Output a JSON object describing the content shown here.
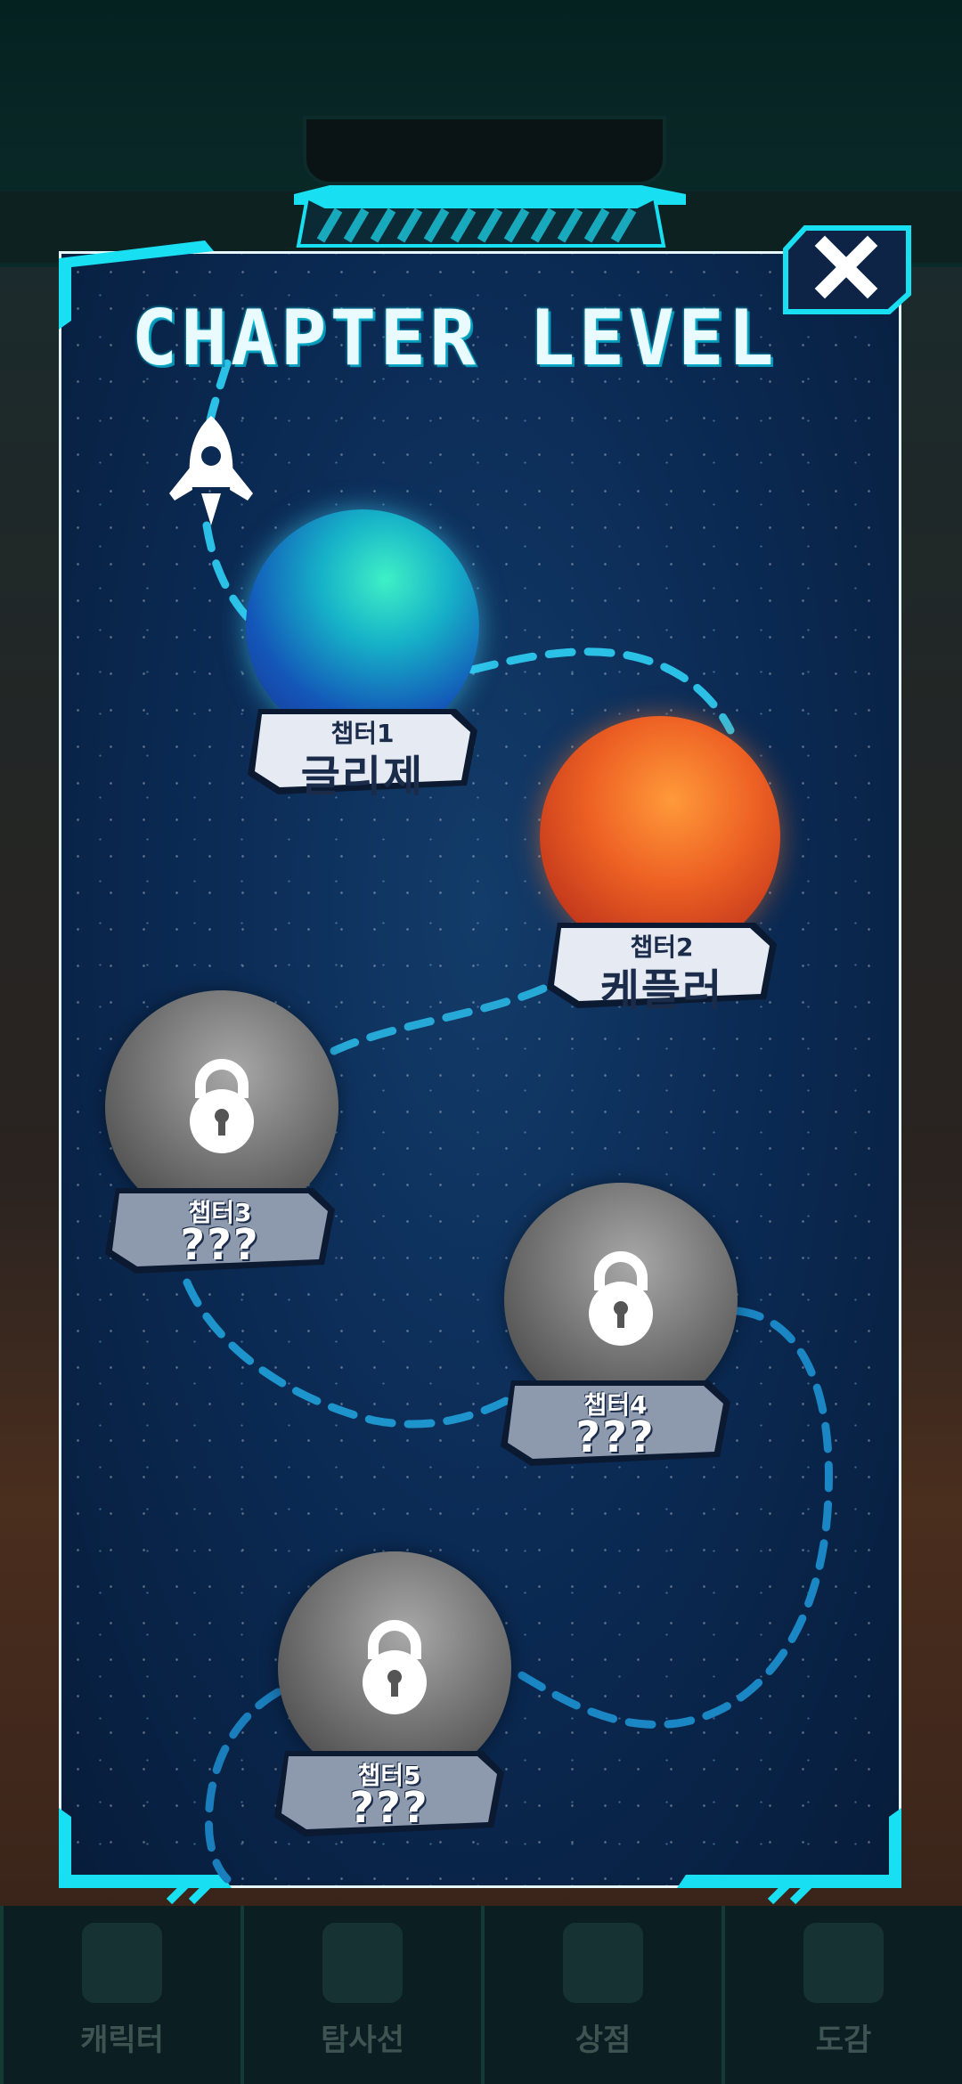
{
  "title": "CHAPTER LEVEL",
  "chapters": [
    {
      "sub": "챕터1",
      "name": "글리제",
      "state": "unlocked",
      "color": "teal"
    },
    {
      "sub": "챕터2",
      "name": "케플러",
      "state": "unlocked",
      "color": "orange"
    },
    {
      "sub": "챕터3",
      "name": "???",
      "state": "locked"
    },
    {
      "sub": "챕터4",
      "name": "???",
      "state": "locked"
    },
    {
      "sub": "챕터5",
      "name": "???",
      "state": "locked"
    }
  ],
  "bottom_nav": [
    {
      "label": "캐릭터",
      "icon": "character-icon"
    },
    {
      "label": "탐사선",
      "icon": "spaceship-icon"
    },
    {
      "label": "상점",
      "icon": "shop-icon"
    },
    {
      "label": "도감",
      "icon": "book-icon"
    }
  ],
  "colors": {
    "frame": "#18e0f2",
    "route": "#1ab0e0",
    "panel": "#0b2b55"
  }
}
